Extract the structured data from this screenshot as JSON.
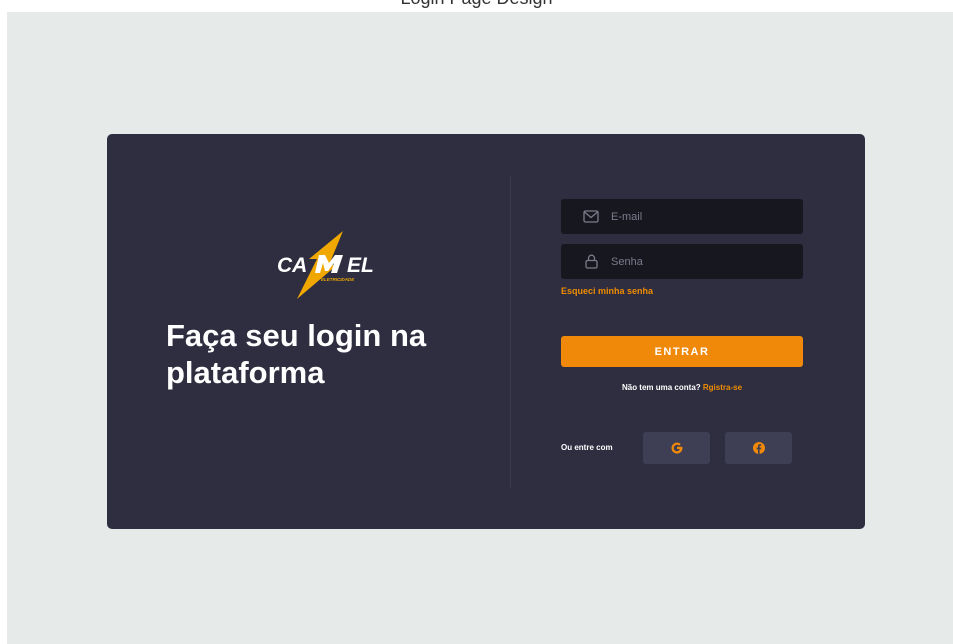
{
  "caption": "Login Page Design",
  "brand": {
    "logo_text": "CAMEL",
    "logo_subtext": "ELETRICIDADE",
    "accent_color": "#f0890a",
    "card_color": "#2e2e40",
    "background_color": "#e6ebea"
  },
  "hero": {
    "headline": "Faça seu login na plataforma"
  },
  "form": {
    "email": {
      "placeholder": "E-mail",
      "value": "",
      "icon": "mail-icon"
    },
    "password": {
      "placeholder": "Senha",
      "value": "",
      "icon": "lock-icon"
    },
    "forgot_label": "Esqueci minha senha",
    "submit_label": "ENTRAR",
    "signup_prompt": "Não tem uma conta?",
    "signup_link": "Rgistra-se"
  },
  "social": {
    "label": "Ou entre com",
    "google_icon": "google-icon",
    "facebook_icon": "facebook-icon"
  }
}
